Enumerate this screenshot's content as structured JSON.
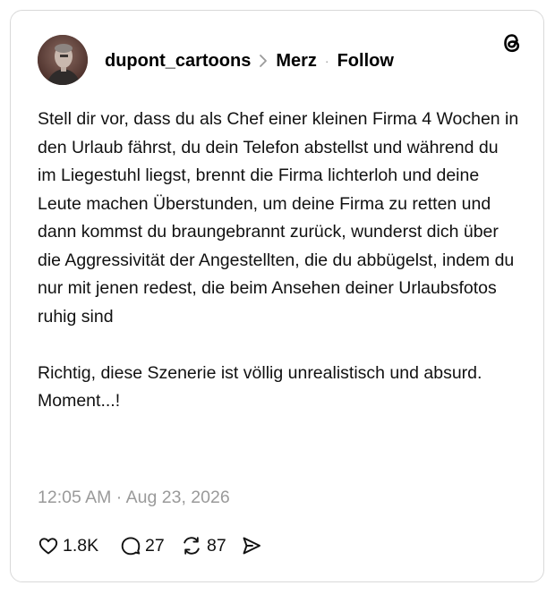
{
  "post": {
    "author": "dupont_cartoons",
    "topic": "Merz",
    "follow_label": "Follow",
    "paragraphs": [
      "Stell dir vor, dass du als Chef einer kleinen Firma 4 Wochen in den Urlaub fährst, du dein Telefon abstellst und während du im Liegestuhl liegst, brennt die Firma lichterloh und deine Leute machen Überstunden, um deine Firma zu retten und dann kommst du braungebrannt zurück, wunderst dich über die Aggressivität der Angestellten, die du abbügelst, indem du nur mit jenen redest, die beim Ansehen deiner Urlaubsfotos ruhig sind",
      "Richtig, diese Szenerie ist völlig unrealistisch und absurd.",
      "Moment...!"
    ],
    "timestamp": "12:05 AM · Aug 23, 2026"
  },
  "actions": {
    "likes": "1.8K",
    "replies": "27",
    "reposts": "87"
  },
  "icons": {
    "app": "threads-logo-icon",
    "separator": "chevron-right-icon",
    "like": "heart-icon",
    "reply": "speech-bubble-icon",
    "repost": "repost-arrows-icon",
    "share": "send-icon"
  },
  "colors": {
    "text": "#111111",
    "muted": "#9a9a9a",
    "border": "#d9d9d9",
    "background": "#ffffff"
  }
}
